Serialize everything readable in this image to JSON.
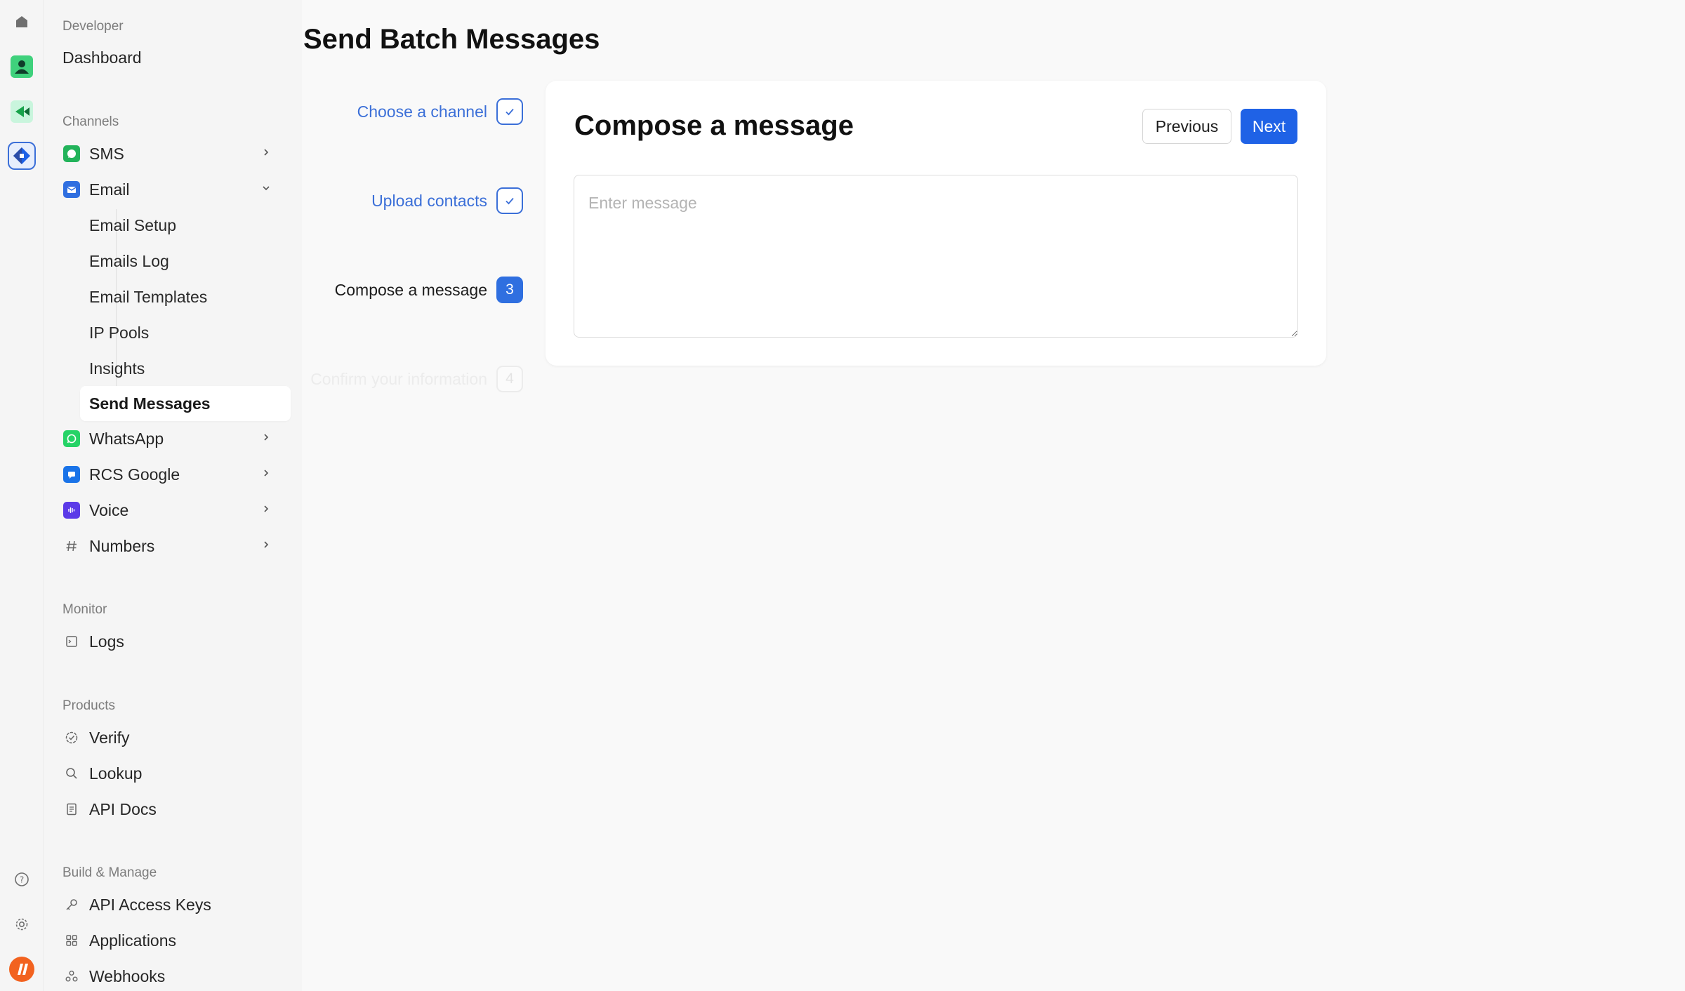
{
  "page": {
    "title": "Send Batch Messages"
  },
  "nav": {
    "developer_label": "Developer",
    "dashboard": "Dashboard",
    "channels_label": "Channels",
    "sms": "SMS",
    "email": "Email",
    "email_sub": [
      "Email Setup",
      "Emails Log",
      "Email Templates",
      "IP Pools",
      "Insights",
      "Send Messages"
    ],
    "whatsapp": "WhatsApp",
    "rcs": "RCS Google",
    "voice": "Voice",
    "numbers": "Numbers",
    "monitor_label": "Monitor",
    "logs": "Logs",
    "products_label": "Products",
    "verify": "Verify",
    "lookup": "Lookup",
    "api_docs": "API Docs",
    "build_label": "Build & Manage",
    "api_keys": "API Access Keys",
    "applications": "Applications",
    "webhooks": "Webhooks"
  },
  "steps": [
    {
      "label": "Choose a channel",
      "state": "done"
    },
    {
      "label": "Upload contacts",
      "state": "done"
    },
    {
      "label": "Compose a message",
      "state": "current",
      "number": "3"
    },
    {
      "label": "Confirm your information",
      "state": "pending",
      "number": "4"
    }
  ],
  "card": {
    "title": "Compose a message",
    "previous": "Previous",
    "next": "Next",
    "placeholder": "Enter message"
  },
  "colors": {
    "accent": "#1f62e6",
    "step_blue": "#3b6fd8"
  }
}
